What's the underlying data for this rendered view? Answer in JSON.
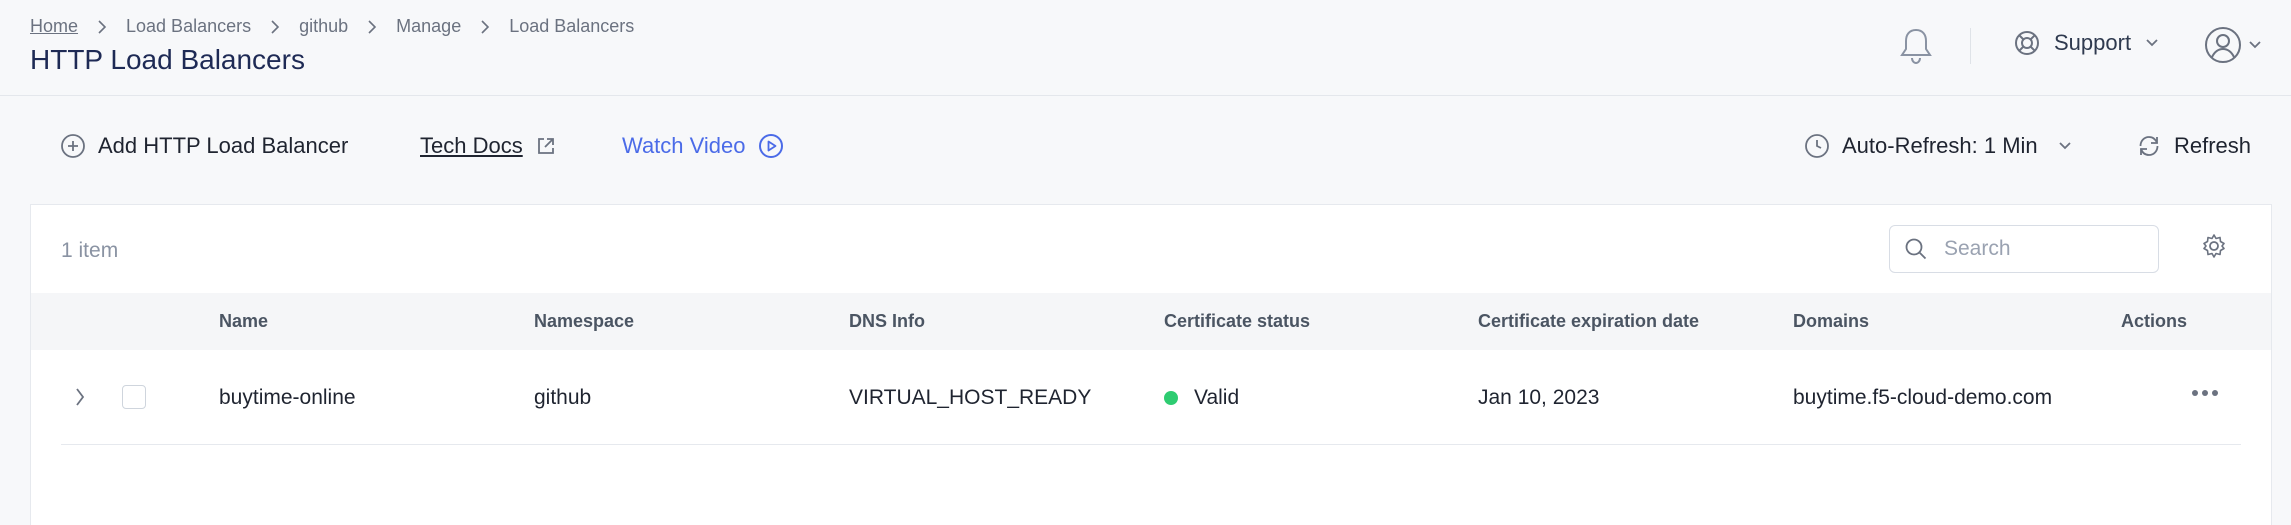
{
  "breadcrumb": [
    "Home",
    "Load Balancers",
    "github",
    "Manage",
    "Load Balancers"
  ],
  "page_title": "HTTP Load Balancers",
  "header": {
    "support_label": "Support",
    "icons": [
      "bell-icon",
      "lifebuoy-icon",
      "user-avatar-icon",
      "chevron-down-icon"
    ]
  },
  "toolbar": {
    "add_label": "Add HTTP Load Balancer",
    "docs_label": "Tech Docs",
    "video_label": "Watch Video",
    "auto_refresh_label": "Auto-Refresh: 1 Min",
    "refresh_label": "Refresh"
  },
  "table": {
    "item_count": "1 item",
    "search_placeholder": "Search",
    "columns": [
      "Name",
      "Namespace",
      "DNS Info",
      "Certificate status",
      "Certificate expiration date",
      "Domains",
      "Actions"
    ],
    "rows": [
      {
        "name": "buytime-online",
        "namespace": "github",
        "dns_info": "VIRTUAL_HOST_READY",
        "cert_status": "Valid",
        "cert_expiration": "Jan 10, 2023",
        "domains": "buytime.f5-cloud-demo.com"
      }
    ]
  },
  "colors": {
    "accent": "#4b6be8",
    "status_valid": "#2ecc71",
    "title": "#1e2a55"
  }
}
